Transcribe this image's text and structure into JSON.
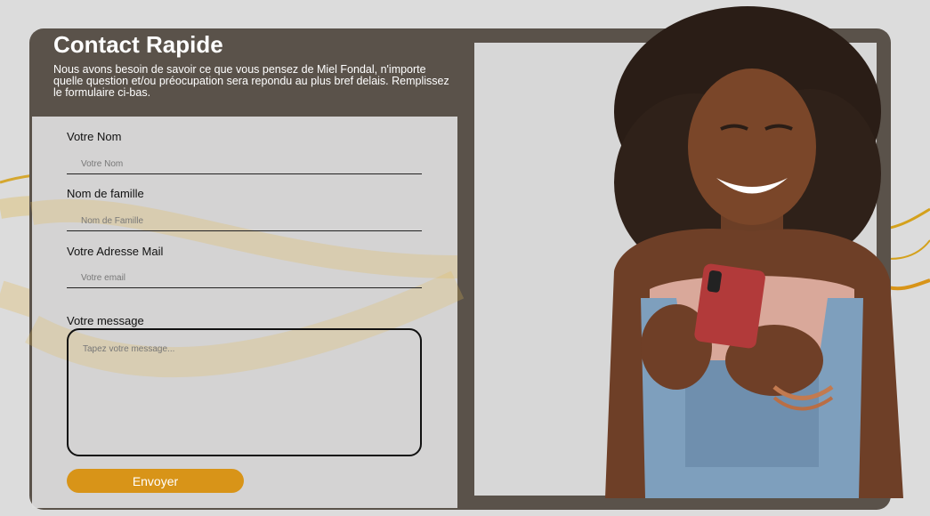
{
  "header": {
    "title": "Contact Rapide",
    "subtitle": "Nous avons besoin de savoir ce que vous pensez de Miel Fondal, n'importe quelle question et/ou préocupation sera repondu au plus bref delais. Remplissez le formulaire ci-bas."
  },
  "form": {
    "first_name": {
      "label": "Votre Nom",
      "placeholder": "Votre Nom",
      "value": ""
    },
    "last_name": {
      "label": "Nom de famille",
      "placeholder": "Nom de Famille",
      "value": ""
    },
    "email": {
      "label": "Votre Adresse Mail",
      "placeholder": "Votre email",
      "value": ""
    },
    "message": {
      "label": "Votre message",
      "placeholder": "Tapez votre message...",
      "value": ""
    },
    "submit_label": "Envoyer"
  },
  "image": {
    "name": "smiling-woman-with-phone"
  },
  "colors": {
    "card": "#5a524a",
    "accent": "#d89418",
    "background": "#dcdcdc"
  }
}
